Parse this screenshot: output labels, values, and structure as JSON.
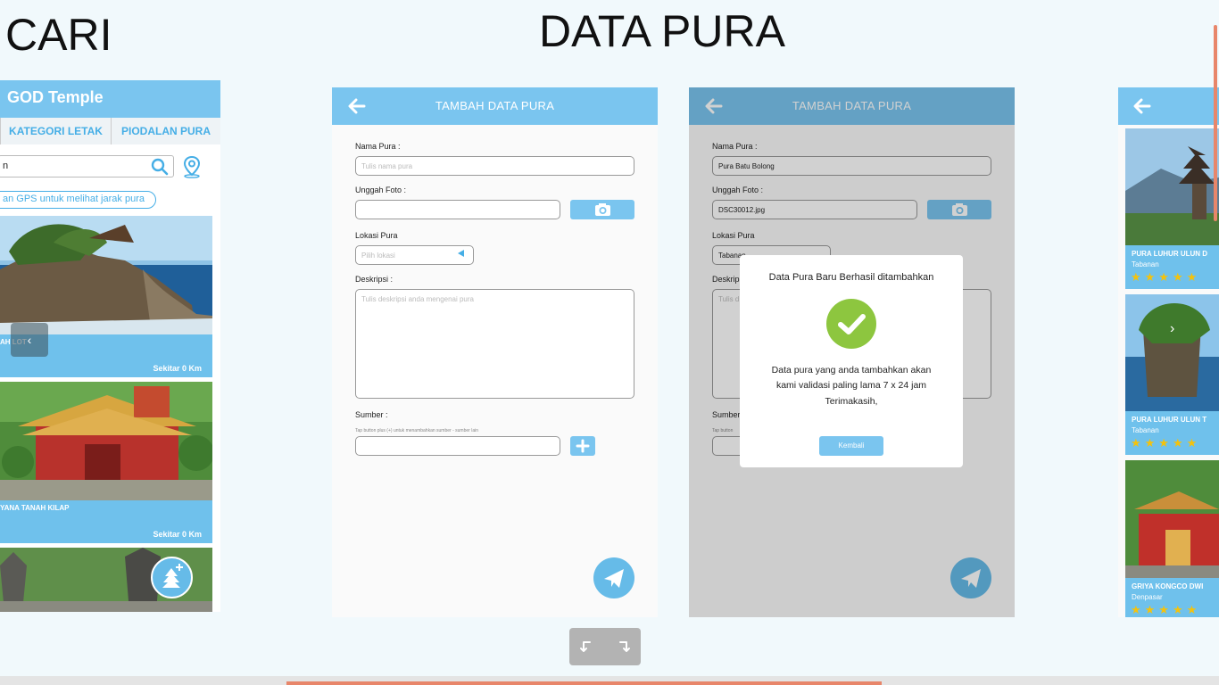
{
  "titles": {
    "cari": "CARI",
    "data_pura": "DATA PURA"
  },
  "left_phone": {
    "app_title": "GOD Temple",
    "tabs": [
      "KATEGORI LETAK",
      "PIODALAN PURA"
    ],
    "search_value": "n",
    "gps_hint": "an GPS untuk melihat jarak pura",
    "cards": [
      {
        "name": "AH LOT",
        "distance": "Sekitar 0 Km"
      },
      {
        "name": "YANA TANAH KILAP",
        "distance": "Sekitar 0 Km"
      }
    ]
  },
  "form": {
    "header_title": "TAMBAH DATA PURA",
    "nama_label": "Nama Pura :",
    "nama_placeholder": "Tulis nama pura",
    "foto_label": "Unggah Foto :",
    "lokasi_label": "Lokasi Pura",
    "lokasi_placeholder": "Pilih lokasi",
    "deskripsi_label": "Deskripsi :",
    "deskripsi_placeholder": "Tulis deskripsi anda mengenai pura",
    "sumber_label": "Sumber :",
    "sumber_hint": "Tap button plus (+) untuk menambahkan sumber - sumber lain"
  },
  "form_filled": {
    "header_title": "TAMBAH DATA PURA",
    "nama_label": "Nama Pura :",
    "nama_value": "Pura Batu Bolong",
    "foto_label": "Unggah Foto :",
    "foto_value": "DSC30012.jpg",
    "lokasi_label": "Lokasi Pura",
    "lokasi_value": "Tabanan",
    "deskripsi_label": "Deskripsi :",
    "deskripsi_placeholder": "Tulis d",
    "sumber_label": "Sumber :",
    "sumber_hint": "Tap button"
  },
  "modal": {
    "title": "Data Pura Baru Berhasil  ditambahkan",
    "line1": "Data pura yang anda tambahkan akan",
    "line2": "kami validasi paling lama  7 x 24 jam",
    "line3": "Terimakasih,",
    "button": "Kembali"
  },
  "right_phone": {
    "cards": [
      {
        "name": "PURA LUHUR ULUN D",
        "location": "Tabanan",
        "rating": 4.5
      },
      {
        "name": "PURA LUHUR ULUN T",
        "location": "Tabanan",
        "rating": 4.5
      },
      {
        "name": "GRIYA KONGCO DWI",
        "location": "Denpasar",
        "rating": 4.5
      }
    ]
  },
  "icons": {
    "back": "arrow-left-icon",
    "camera": "camera-icon",
    "send": "paper-plane-icon",
    "plus": "plus-icon",
    "check": "check-circle-icon",
    "search": "search-icon",
    "location": "location-pin-icon",
    "undo": "undo-icon",
    "redo": "redo-icon"
  },
  "colors": {
    "accent": "#7ac5ef",
    "accent_dark": "#45aee6",
    "success": "#8dc63f",
    "star": "#f4c20d",
    "scroll": "#e8866a"
  }
}
